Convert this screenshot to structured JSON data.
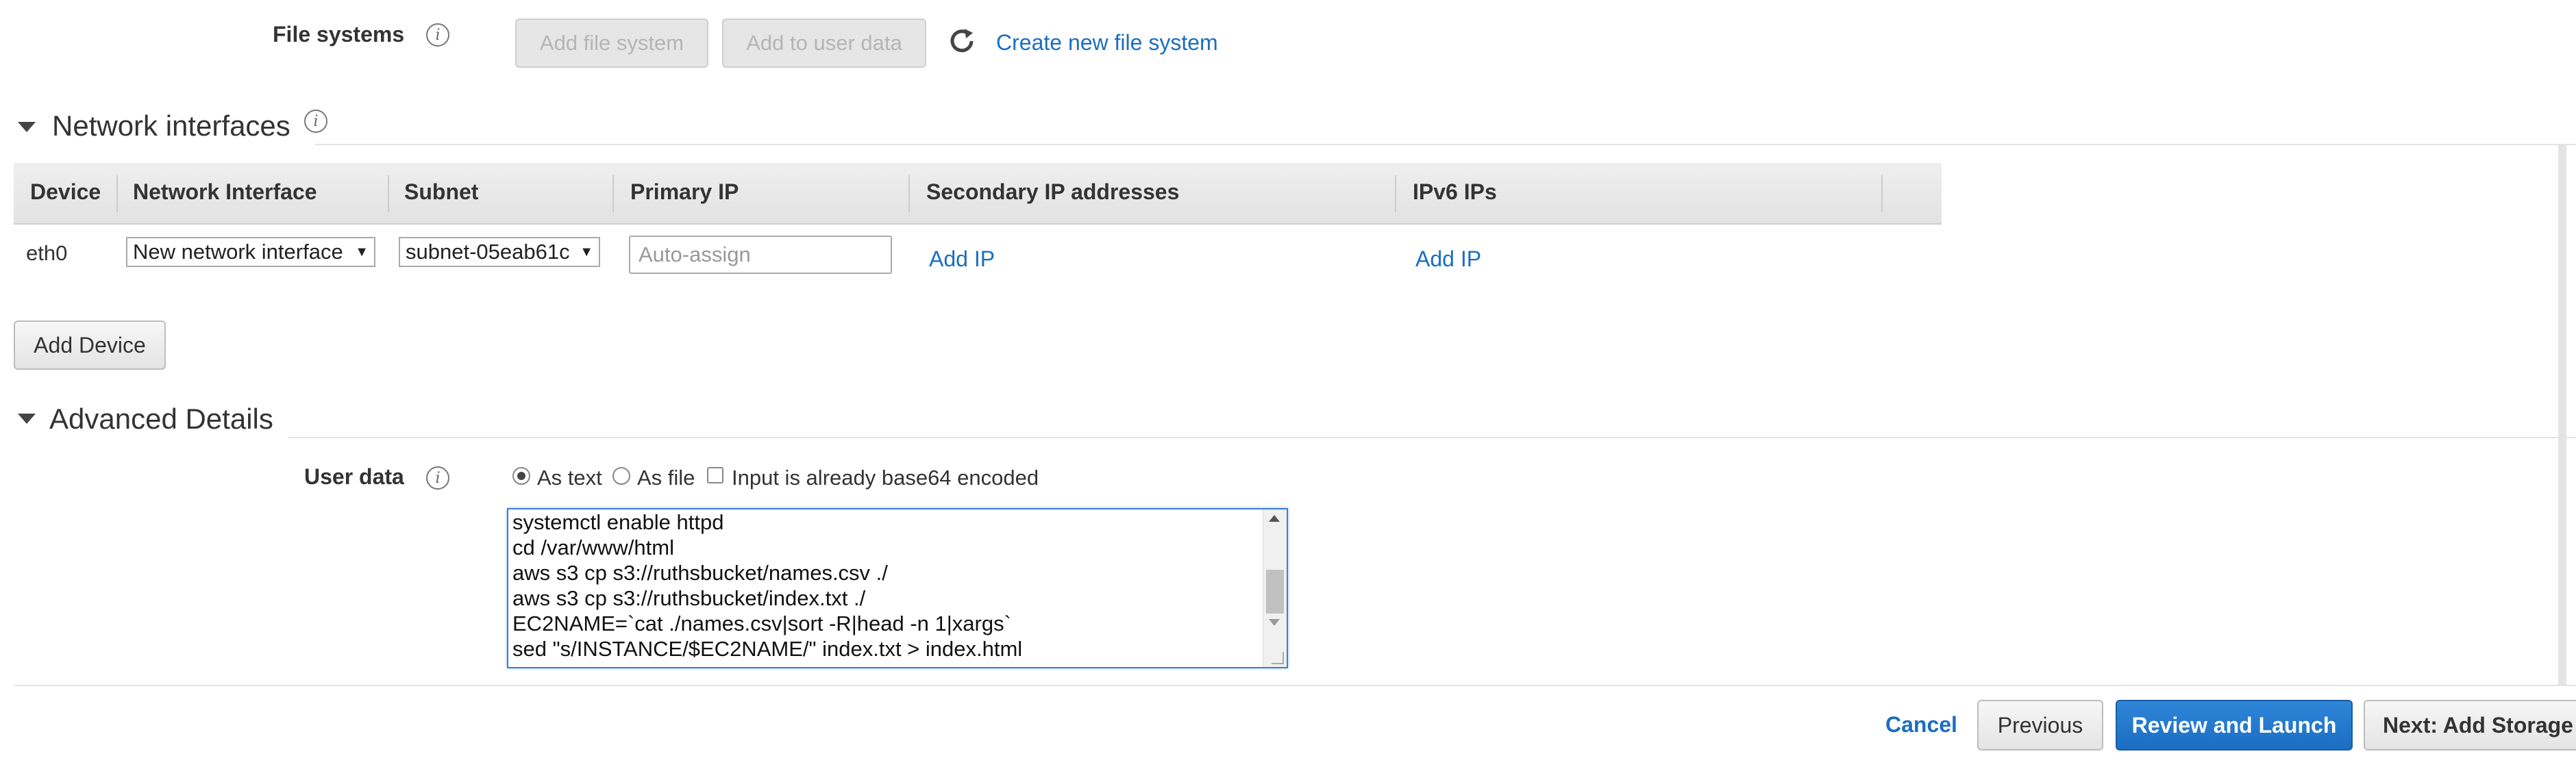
{
  "file_systems": {
    "label": "File systems",
    "add_file_system": "Add file system",
    "add_to_user_data": "Add to user data",
    "create_new": "Create new file system"
  },
  "network_interfaces": {
    "title": "Network interfaces",
    "columns": [
      "Device",
      "Network Interface",
      "Subnet",
      "Primary IP",
      "Secondary IP addresses",
      "IPv6 IPs"
    ],
    "row": {
      "device": "eth0",
      "network_interface": "New network interface",
      "subnet": "subnet-05eab61c",
      "primary_ip_placeholder": "Auto-assign",
      "secondary_add": "Add IP",
      "ipv6_add": "Add IP"
    },
    "add_device": "Add Device"
  },
  "advanced": {
    "title": "Advanced Details",
    "user_data_label": "User data",
    "as_text": "As text",
    "as_file": "As file",
    "base64": "Input is already base64 encoded",
    "selected": "As text",
    "lines": [
      "systemctl enable httpd",
      "cd /var/www/html",
      "aws s3 cp s3://ruthsbucket/names.csv ./",
      "aws s3 cp s3://ruthsbucket/index.txt ./",
      "EC2NAME=`cat ./names.csv|sort -R|head -n 1|xargs`",
      "sed \"s/INSTANCE/$EC2NAME/\" index.txt > index.html"
    ]
  },
  "footer": {
    "cancel": "Cancel",
    "previous": "Previous",
    "review": "Review and Launch",
    "next": "Next: Add Storage"
  },
  "icons": {
    "info": "info-icon",
    "refresh": "refresh-icon",
    "collapse": "triangle-down-icon"
  },
  "colors": {
    "link": "#1b6ec2",
    "primary": "#1b6ec2",
    "table_header": "#e9e9e9"
  }
}
